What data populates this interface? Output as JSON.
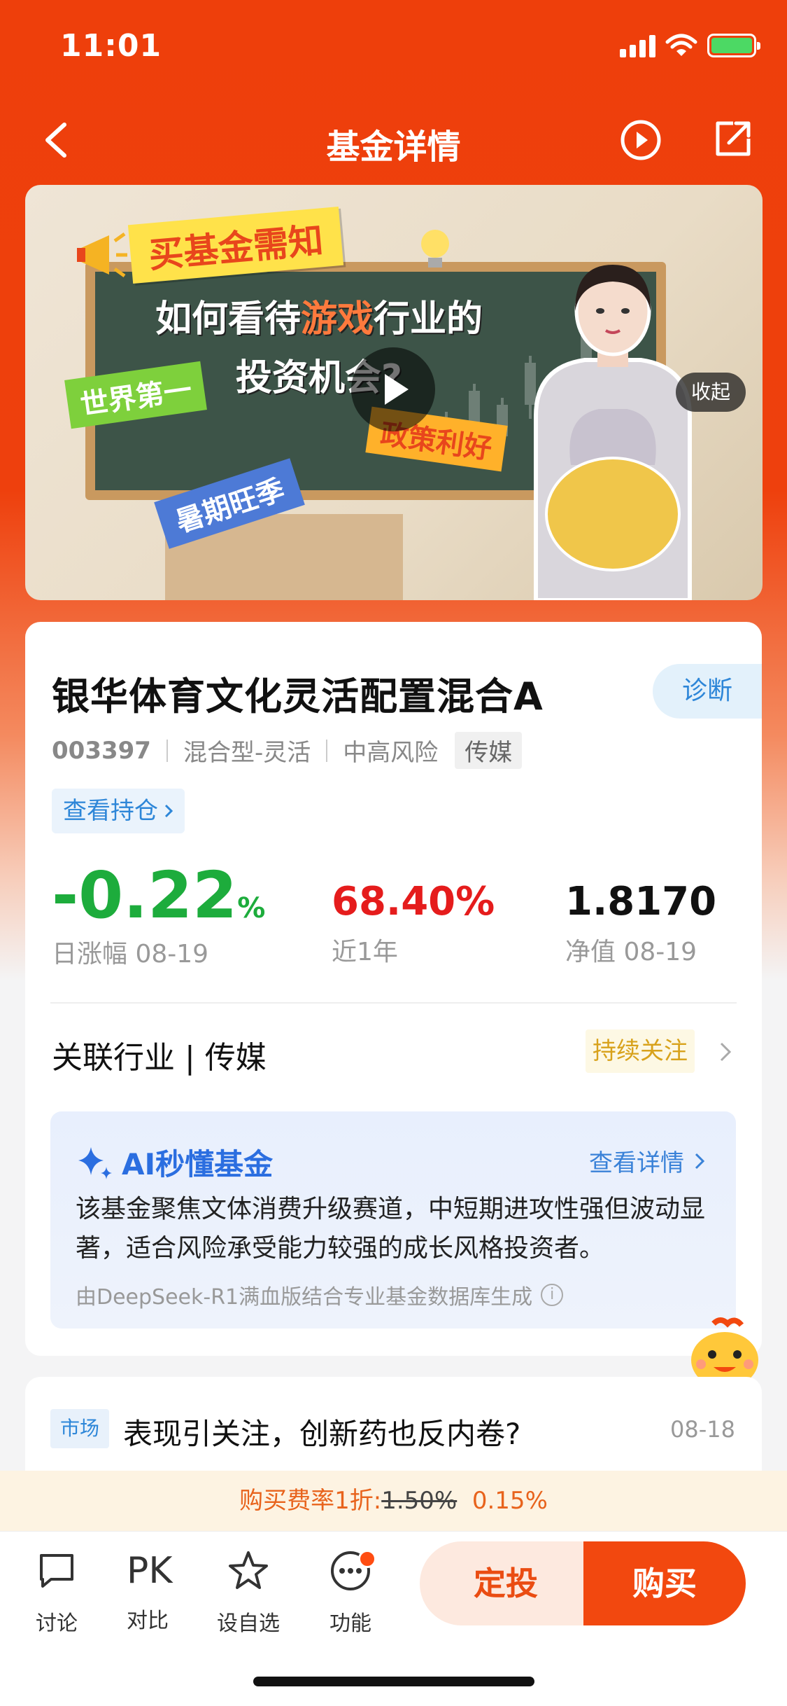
{
  "status": {
    "time": "11:01"
  },
  "nav": {
    "title": "基金详情"
  },
  "banner": {
    "tag_top": "买基金需知",
    "headline_pre": "如何看待",
    "headline_hl": "游戏",
    "headline_post": "行业的",
    "headline_line2": "投资机会?",
    "tag_green": "世界第一",
    "tag_orange": "政策利好",
    "tag_blue": "暑期旺季",
    "collapse": "收起"
  },
  "fund": {
    "name": "银华体育文化灵活配置混合A",
    "diagnose": "诊断",
    "code": "003397",
    "type": "混合型-灵活",
    "risk": "中高风险",
    "sector_chip": "传媒",
    "holdings": "查看持仓",
    "daily_change": "-0.22",
    "daily_unit": "%",
    "daily_label": "日涨幅 08-19",
    "year_return": "68.40%",
    "year_label": "近1年",
    "nav_value": "1.8170",
    "nav_label": "净值 08-19",
    "industry": "关联行业 | 传媒",
    "follow": "持续关注"
  },
  "ai": {
    "title": "AI秒懂基金",
    "more": "查看详情",
    "desc": "该基金聚焦文体消费升级赛道，中短期进攻性强但波动显著，适合风险承受能力较强的成长风格投资者。",
    "source": "由DeepSeek-R1满血版结合专业基金数据库生成"
  },
  "news": {
    "tag": "市场",
    "headline": "表现引关注，创新药也反内卷?",
    "date": "08-18"
  },
  "fee": {
    "prefix": "购买费率1折:",
    "old": "1.50%",
    "new": "0.15%"
  },
  "toolbar": {
    "discuss": "讨论",
    "pk": "PK",
    "compare": "对比",
    "watchlist": "设自选",
    "functions": "功能",
    "sip": "定投",
    "buy": "购买"
  },
  "colors": {
    "brand": "#ee3f0b",
    "up": "#e51c1c",
    "down": "#1dac3c",
    "link": "#2d86d8"
  }
}
